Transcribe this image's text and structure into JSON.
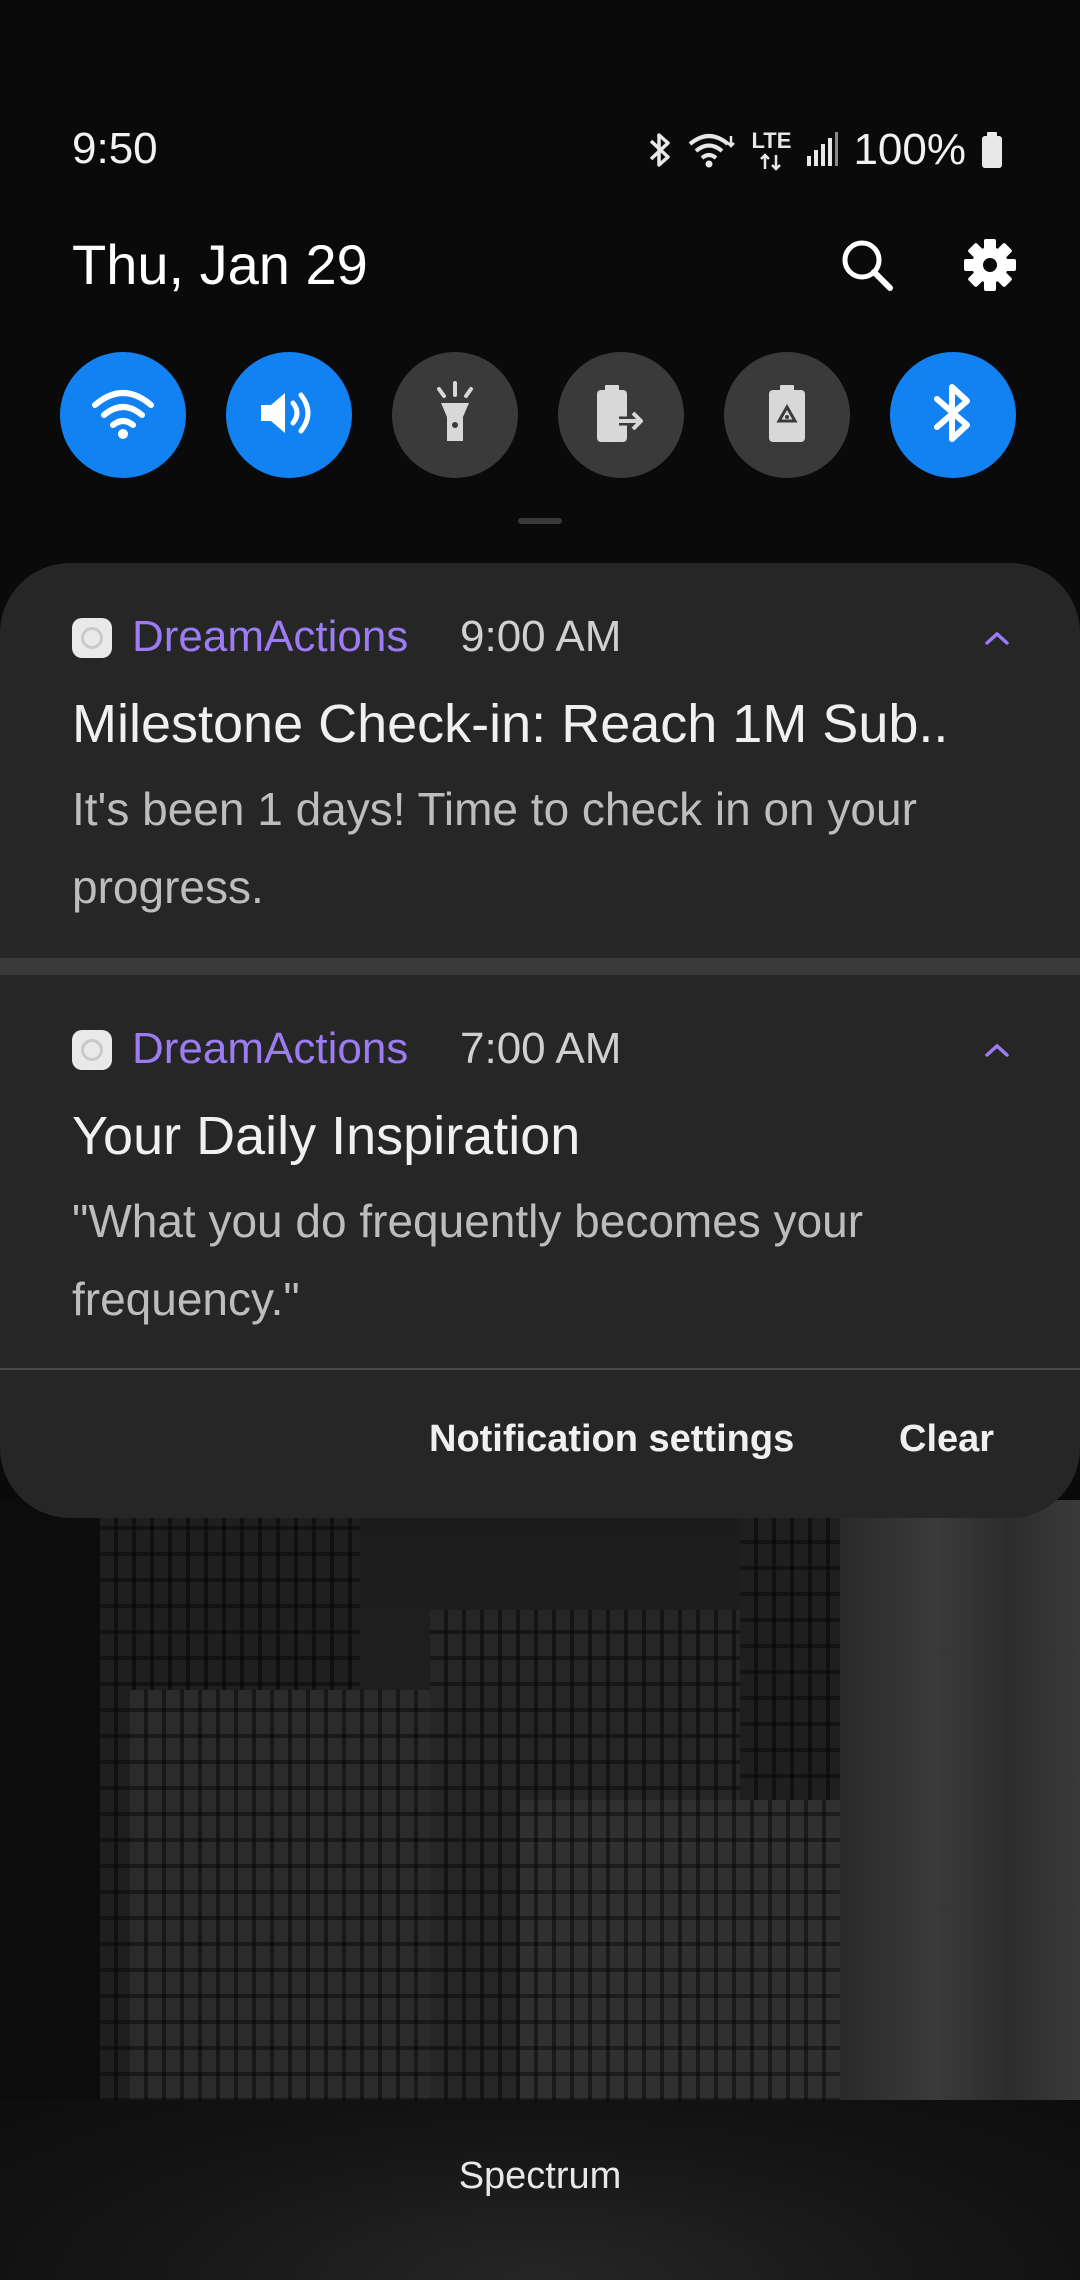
{
  "status_bar": {
    "time": "9:50",
    "battery_percent": "100%",
    "network_label": "LTE",
    "icons": [
      "bluetooth-icon",
      "wifi-icon",
      "lte-icon",
      "signal-icon",
      "battery-icon"
    ]
  },
  "header": {
    "date": "Thu, Jan 29",
    "icons": [
      "search-icon",
      "settings-icon"
    ]
  },
  "quick_toggles": [
    {
      "name": "wifi",
      "icon": "wifi-icon",
      "on": true
    },
    {
      "name": "sound",
      "icon": "volume-icon",
      "on": true
    },
    {
      "name": "flashlight",
      "icon": "flashlight-icon",
      "on": false
    },
    {
      "name": "power-share",
      "icon": "battery-share-icon",
      "on": false
    },
    {
      "name": "power-saving",
      "icon": "battery-recycle-icon",
      "on": false
    },
    {
      "name": "bluetooth",
      "icon": "bluetooth-icon",
      "on": true
    }
  ],
  "colors": {
    "toggle_on": "#1282f3",
    "toggle_off": "#3a3a3a",
    "app_name": "#9b7cf2",
    "panel": "#262626"
  },
  "notifications": [
    {
      "app_name": "DreamActions",
      "time": "9:00 AM",
      "title": "Milestone Check-in: Reach 1M Sub..",
      "body": "It's been 1 days! Time to check in on your progress."
    },
    {
      "app_name": "DreamActions",
      "time": "7:00 AM",
      "title": "Your Daily Inspiration",
      "body": "\"What you do frequently becomes your frequency.\""
    }
  ],
  "footer": {
    "settings_label": "Notification settings",
    "clear_label": "Clear"
  },
  "carrier": "Spectrum"
}
